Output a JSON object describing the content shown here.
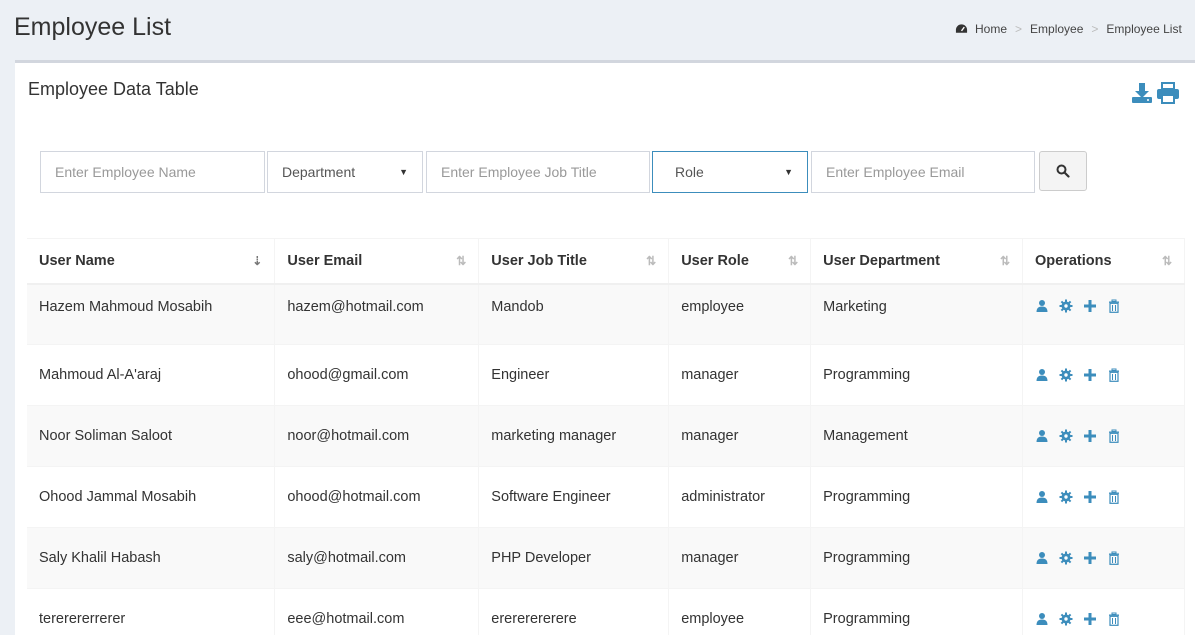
{
  "header": {
    "title": "Employee List",
    "breadcrumb": [
      "Home",
      "Employee",
      "Employee List"
    ]
  },
  "panel": {
    "title": "Employee Data Table"
  },
  "filters": {
    "name_placeholder": "Enter Employee Name",
    "department_value": "Department",
    "job_title_placeholder": "Enter Employee Job Title",
    "role_value": "Role",
    "email_placeholder": "Enter Employee Email"
  },
  "table": {
    "columns": [
      "User Name",
      "User Email",
      "User Job Title",
      "User Role",
      "User Department",
      "Operations"
    ],
    "rows": [
      {
        "name": "Hazem Mahmoud Mosabih",
        "email": "hazem@hotmail.com",
        "job": "Mandob",
        "role": "employee",
        "department": "Marketing"
      },
      {
        "name": "Mahmoud Al-A'araj",
        "email": "ohood@gmail.com",
        "job": "Engineer",
        "role": "manager",
        "department": "Programming"
      },
      {
        "name": "Noor Soliman Saloot",
        "email": "noor@hotmail.com",
        "job": "marketing manager",
        "role": "manager",
        "department": "Management"
      },
      {
        "name": "Ohood Jammal Mosabih",
        "email": "ohood@hotmail.com",
        "job": "Software Engineer",
        "role": "administrator",
        "department": "Programming"
      },
      {
        "name": "Saly Khalil Habash",
        "email": "saly@hotmail.com",
        "job": "PHP Developer",
        "role": "manager",
        "department": "Programming"
      },
      {
        "name": "tererererrerer",
        "email": "eee@hotmail.com",
        "job": "erererererere",
        "role": "employee",
        "department": "Programming"
      }
    ]
  },
  "colors": {
    "accent": "#3c8dbc",
    "page_bg": "#ecf0f5"
  },
  "icons": {
    "breadcrumb": "dashboard-icon",
    "tools": [
      "download-icon",
      "print-icon"
    ],
    "operations": [
      "user-icon",
      "gear-icon",
      "plus-icon",
      "trash-icon"
    ],
    "search": "search-icon"
  }
}
